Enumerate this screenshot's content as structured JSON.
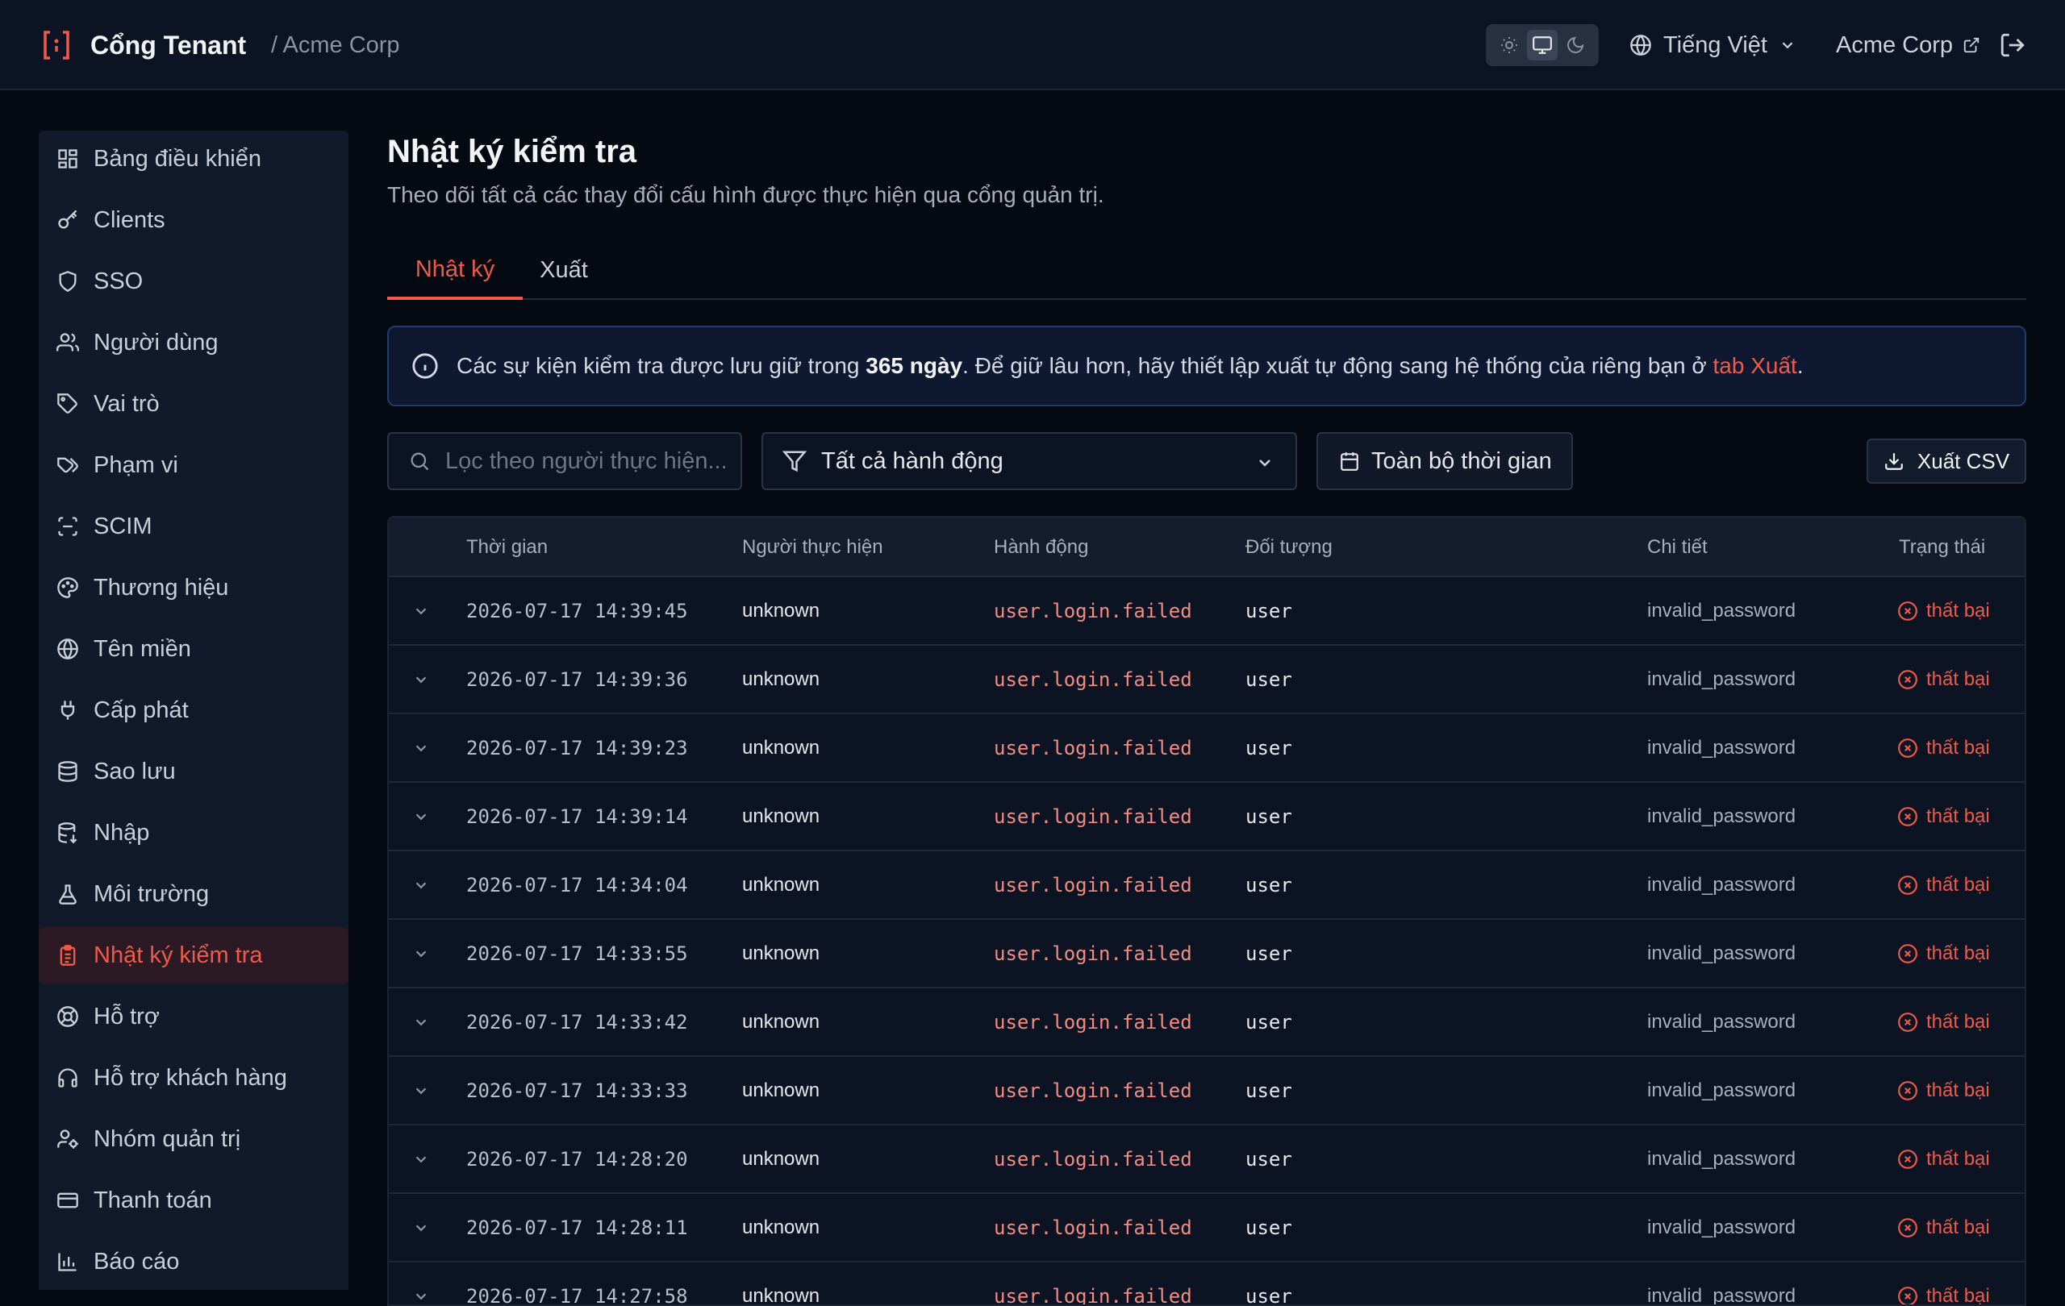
{
  "header": {
    "brand_name": "Cổng Tenant",
    "brand_org": "/ Acme Corp",
    "language": "Tiếng Việt",
    "org_link": "Acme Corp"
  },
  "sidebar": {
    "items": [
      {
        "label": "Bảng điều khiển",
        "icon": "dashboard-icon"
      },
      {
        "label": "Clients",
        "icon": "key-icon"
      },
      {
        "label": "SSO",
        "icon": "shield-icon"
      },
      {
        "label": "Người dùng",
        "icon": "users-icon"
      },
      {
        "label": "Vai trò",
        "icon": "tag-icon"
      },
      {
        "label": "Phạm vi",
        "icon": "tags-icon"
      },
      {
        "label": "SCIM",
        "icon": "scan-icon"
      },
      {
        "label": "Thương hiệu",
        "icon": "palette-icon"
      },
      {
        "label": "Tên miền",
        "icon": "globe-icon"
      },
      {
        "label": "Cấp phát",
        "icon": "plug-icon"
      },
      {
        "label": "Sao lưu",
        "icon": "database-icon"
      },
      {
        "label": "Nhập",
        "icon": "database-import-icon"
      },
      {
        "label": "Môi trường",
        "icon": "flask-icon"
      },
      {
        "label": "Nhật ký kiểm tra",
        "icon": "clipboard-icon",
        "active": true
      },
      {
        "label": "Hỗ trợ",
        "icon": "lifebuoy-icon"
      },
      {
        "label": "Hỗ trợ khách hàng",
        "icon": "headset-icon"
      },
      {
        "label": "Nhóm quản trị",
        "icon": "user-cog-icon"
      },
      {
        "label": "Thanh toán",
        "icon": "credit-card-icon"
      },
      {
        "label": "Báo cáo",
        "icon": "bar-chart-icon"
      }
    ]
  },
  "page": {
    "title": "Nhật ký kiểm tra",
    "subtitle": "Theo dõi tất cả các thay đổi cấu hình được thực hiện qua cổng quản trị."
  },
  "tabs": {
    "log": "Nhật ký",
    "export": "Xuất"
  },
  "notice": {
    "text_before": "Các sự kiện kiểm tra được lưu giữ trong ",
    "bold": "365 ngày",
    "text_after": ". Để giữ lâu hơn, hãy thiết lập xuất tự động sang hệ thống của riêng bạn ở ",
    "link": "tab Xuất",
    "end": "."
  },
  "filters": {
    "search_placeholder": "Lọc theo người thực hiện...",
    "action_filter": "Tất cả hành động",
    "time_range": "Toàn bộ thời gian",
    "export_csv": "Xuất CSV"
  },
  "table": {
    "columns": {
      "time": "Thời gian",
      "actor": "Người thực hiện",
      "action": "Hành động",
      "target": "Đối tượng",
      "detail": "Chi tiết",
      "status": "Trạng thái"
    },
    "rows": [
      {
        "time": "2026-07-17 14:39:45",
        "actor": "unknown",
        "action": "user.login.failed",
        "target": "user",
        "detail": "invalid_password",
        "status": "thất bại"
      },
      {
        "time": "2026-07-17 14:39:36",
        "actor": "unknown",
        "action": "user.login.failed",
        "target": "user",
        "detail": "invalid_password",
        "status": "thất bại"
      },
      {
        "time": "2026-07-17 14:39:23",
        "actor": "unknown",
        "action": "user.login.failed",
        "target": "user",
        "detail": "invalid_password",
        "status": "thất bại"
      },
      {
        "time": "2026-07-17 14:39:14",
        "actor": "unknown",
        "action": "user.login.failed",
        "target": "user",
        "detail": "invalid_password",
        "status": "thất bại"
      },
      {
        "time": "2026-07-17 14:34:04",
        "actor": "unknown",
        "action": "user.login.failed",
        "target": "user",
        "detail": "invalid_password",
        "status": "thất bại"
      },
      {
        "time": "2026-07-17 14:33:55",
        "actor": "unknown",
        "action": "user.login.failed",
        "target": "user",
        "detail": "invalid_password",
        "status": "thất bại"
      },
      {
        "time": "2026-07-17 14:33:42",
        "actor": "unknown",
        "action": "user.login.failed",
        "target": "user",
        "detail": "invalid_password",
        "status": "thất bại"
      },
      {
        "time": "2026-07-17 14:33:33",
        "actor": "unknown",
        "action": "user.login.failed",
        "target": "user",
        "detail": "invalid_password",
        "status": "thất bại"
      },
      {
        "time": "2026-07-17 14:28:20",
        "actor": "unknown",
        "action": "user.login.failed",
        "target": "user",
        "detail": "invalid_password",
        "status": "thất bại"
      },
      {
        "time": "2026-07-17 14:28:11",
        "actor": "unknown",
        "action": "user.login.failed",
        "target": "user",
        "detail": "invalid_password",
        "status": "thất bại"
      },
      {
        "time": "2026-07-17 14:27:58",
        "actor": "unknown",
        "action": "user.login.failed",
        "target": "user",
        "detail": "invalid_password",
        "status": "thất bại"
      }
    ]
  },
  "colors": {
    "accent": "#ef5a4a",
    "background": "#050912",
    "panel": "#0c1322"
  }
}
